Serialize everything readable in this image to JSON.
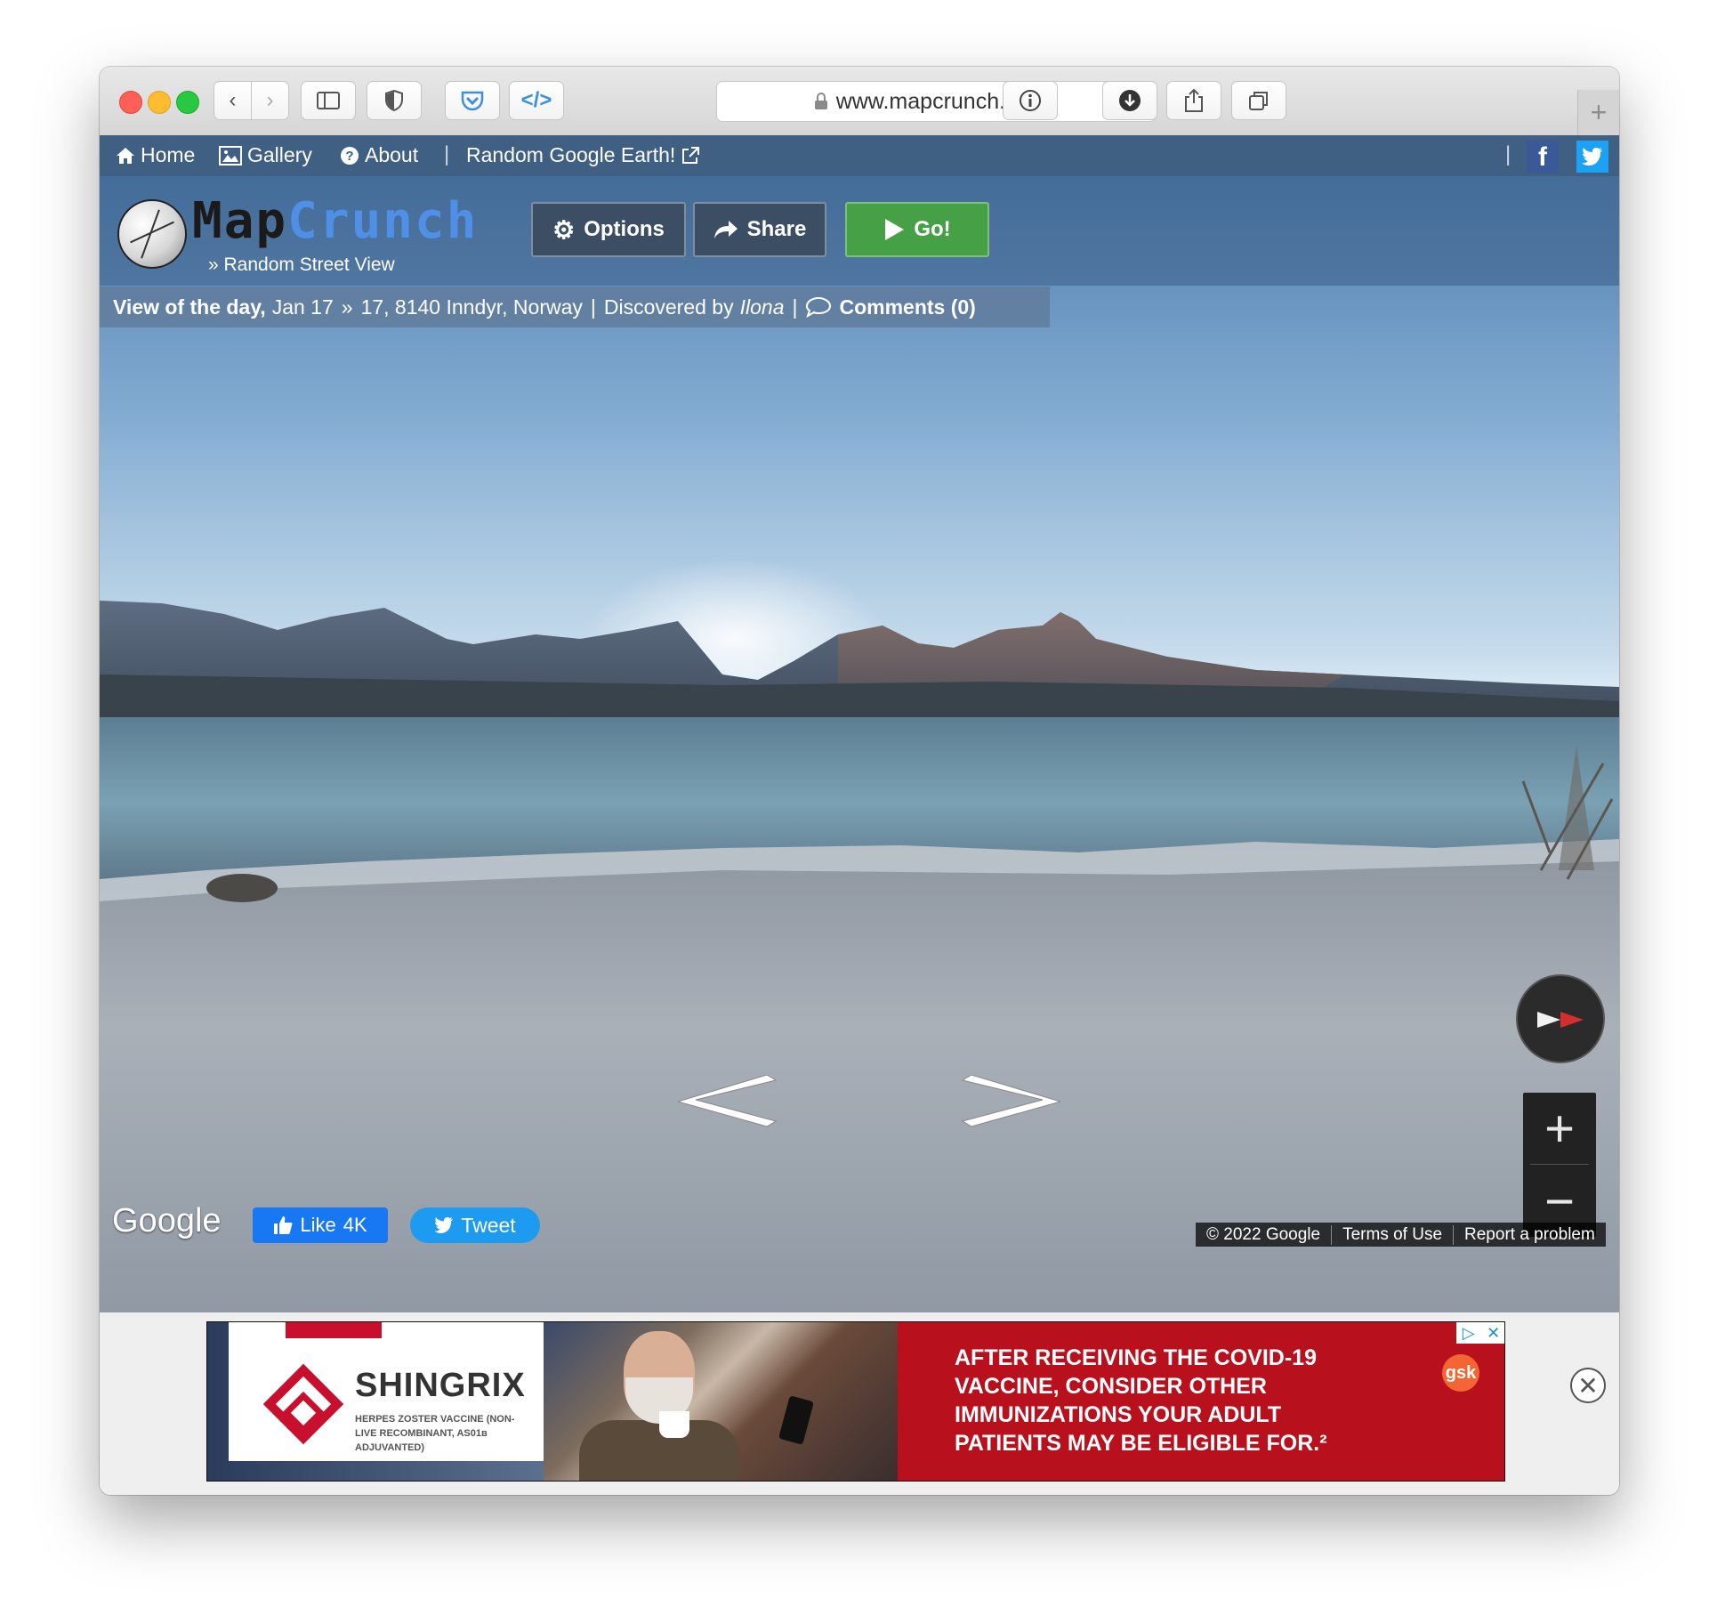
{
  "browser": {
    "url": "www.mapcrunch.com",
    "icons": [
      "back-icon",
      "forward-icon",
      "sidebar-icon",
      "shield-icon",
      "pocket-icon",
      "code-icon",
      "reload-icon",
      "info-icon",
      "download-icon",
      "share-icon",
      "tabs-icon",
      "new-tab-icon"
    ],
    "new_tab_symbol": "+"
  },
  "nav": {
    "home": "Home",
    "gallery": "Gallery",
    "about": "About",
    "sep": "|",
    "earth": "Random Google Earth!",
    "sep2": "|"
  },
  "header": {
    "brand_map": "Map",
    "brand_crunch": "Crunch",
    "tagline": "» Random Street View",
    "options": "Options",
    "share": "Share",
    "go": "Go!"
  },
  "vod": {
    "label": "View of the day,",
    "date": "Jan 17",
    "chevron": "»",
    "location": "17, 8140 Inndyr, Norway",
    "sep": "|",
    "discovered_by": "Discovered by",
    "discoverer": "Ilona",
    "sep2": "|",
    "comments": "Comments (0)"
  },
  "streetview": {
    "google": "Google",
    "like": "Like",
    "like_count": "4K",
    "tweet": "Tweet",
    "copyright": "© 2022 Google",
    "terms": "Terms of Use",
    "report": "Report a problem",
    "zoom_in": "+",
    "zoom_out": "−"
  },
  "ad": {
    "brand": "SHINGRIX",
    "sub": "HERPES ZOSTER VACCINE (NON-LIVE RECOMBINANT, AS01ʙ ADJUVANTED)",
    "message": "AFTER RECEIVING THE COVID-19 VACCINE, CONSIDER OTHER IMMUNIZATIONS YOUR ADULT PATIENTS MAY BE ELIGIBLE FOR.²",
    "sponsor": "gsk",
    "close": "✕"
  },
  "colors": {
    "nav_bg": "#3f5f83",
    "go_green": "#45a046",
    "ad_red": "#b8101c",
    "crunch_blue": "#4f8fe6"
  }
}
